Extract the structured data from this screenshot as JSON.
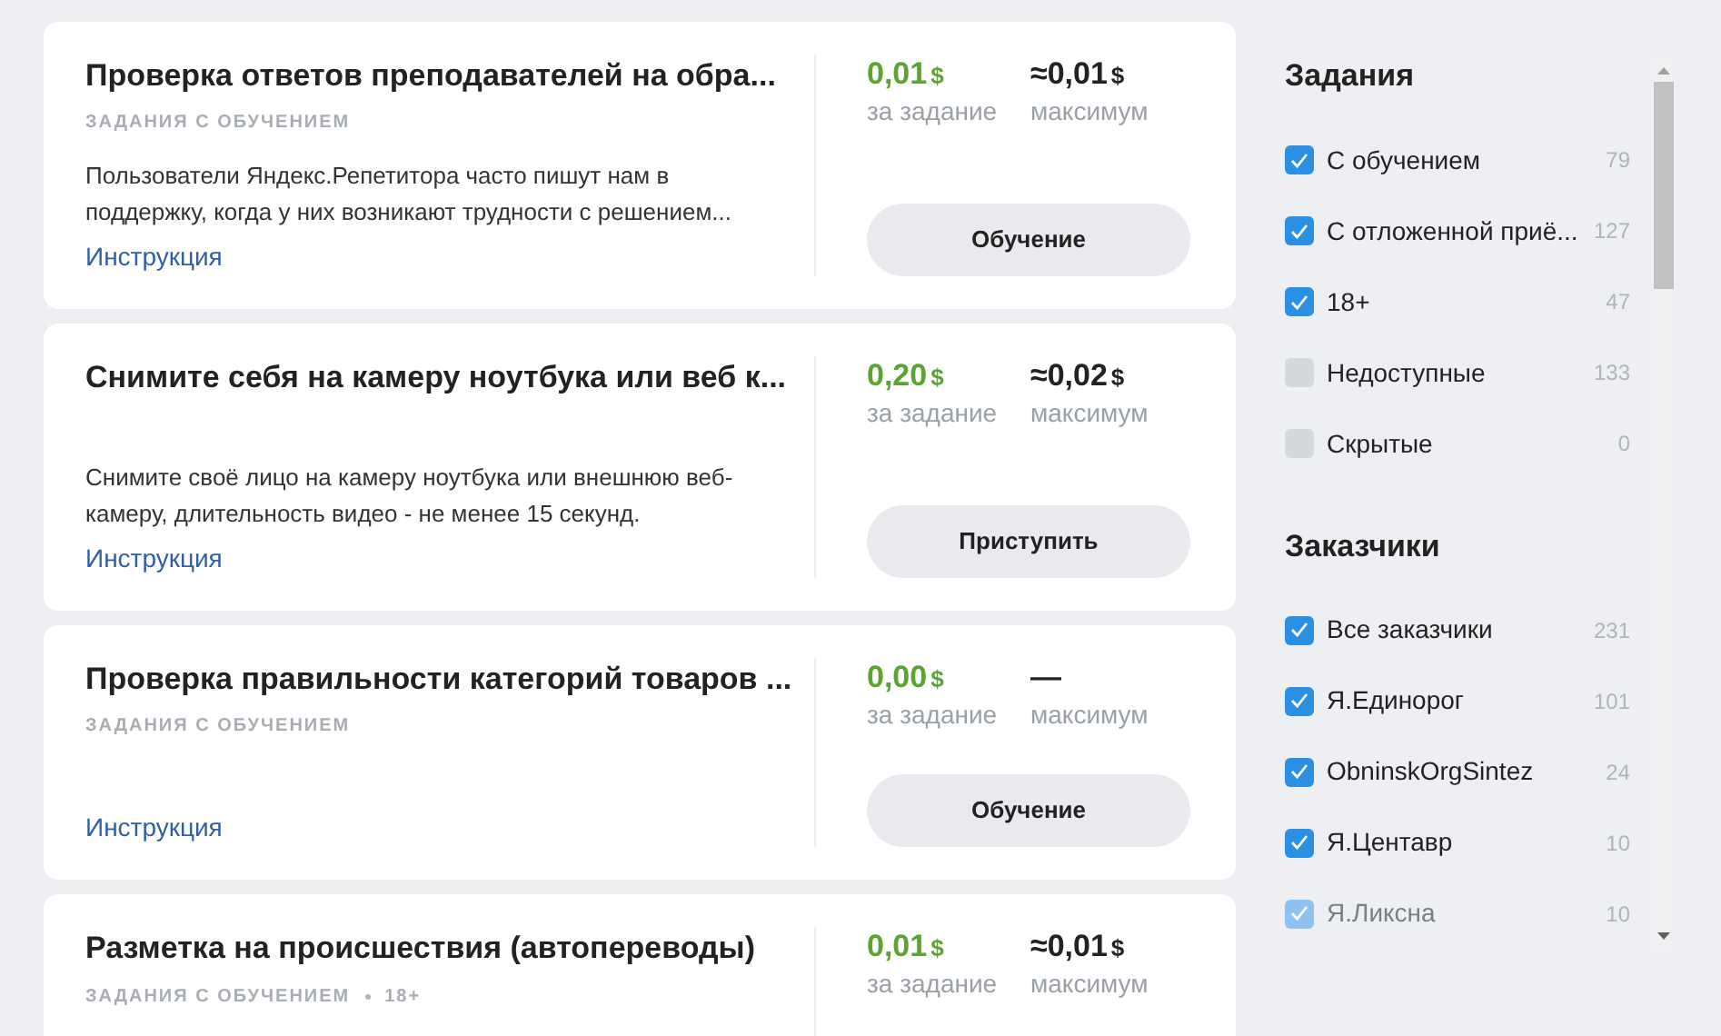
{
  "tasks": [
    {
      "title": "Проверка ответов преподавателей на обра...",
      "tags": [
        "ЗАДАНИЯ С ОБУЧЕНИЕМ"
      ],
      "description": "Пользователи Яндекс.Репетитора часто пишут нам в поддержку, когда у них возникают трудности с решением...",
      "link": "Инструкция",
      "reward": {
        "value": "0,01",
        "currency": "$",
        "caption": "за задание"
      },
      "maximum": {
        "value": "≈0,01",
        "currency": "$",
        "caption": "максимум"
      },
      "button": "Обучение"
    },
    {
      "title": "Снимите себя на камеру ноутбука или веб к...",
      "description": "Снимите своё лицо на камеру ноутбука или внешнюю веб-камеру, длительность видео - не менее 15 секунд.",
      "link": "Инструкция",
      "reward": {
        "value": "0,20",
        "currency": "$",
        "caption": "за задание"
      },
      "maximum": {
        "value": "≈0,02",
        "currency": "$",
        "caption": "максимум"
      },
      "button": "Приступить"
    },
    {
      "title": "Проверка правильности категорий товаров ...",
      "tags": [
        "ЗАДАНИЯ С ОБУЧЕНИЕМ"
      ],
      "link": "Инструкция",
      "reward": {
        "value": "0,00",
        "currency": "$",
        "caption": "за задание"
      },
      "maximum": {
        "value": "—",
        "caption": "максимум"
      },
      "button": "Обучение"
    },
    {
      "title": "Разметка на происшествия (автопереводы)",
      "tags": [
        "ЗАДАНИЯ С ОБУЧЕНИЕМ",
        "18+"
      ],
      "reward": {
        "value": "0,01",
        "currency": "$",
        "caption": "за задание"
      },
      "maximum": {
        "value": "≈0,01",
        "currency": "$",
        "caption": "максимум"
      }
    }
  ],
  "filters": [
    {
      "title": "Задания",
      "items": [
        {
          "label": "С обучением",
          "count": "79",
          "checked": true
        },
        {
          "label": "С отложенной приё...",
          "count": "127",
          "checked": true
        },
        {
          "label": "18+",
          "count": "47",
          "checked": true
        },
        {
          "label": "Недоступные",
          "count": "133",
          "checked": false
        },
        {
          "label": "Скрытые",
          "count": "0",
          "checked": false
        }
      ]
    },
    {
      "title": "Заказчики",
      "items": [
        {
          "label": "Все заказчики",
          "count": "231",
          "checked": true
        },
        {
          "label": "Я.Единорог",
          "count": "101",
          "checked": true
        },
        {
          "label": "ObninskOrgSintez",
          "count": "24",
          "checked": true
        },
        {
          "label": "Я.Центавр",
          "count": "10",
          "checked": true
        },
        {
          "label": "Я.Ликсна",
          "count": "10",
          "checked": true
        }
      ]
    }
  ]
}
